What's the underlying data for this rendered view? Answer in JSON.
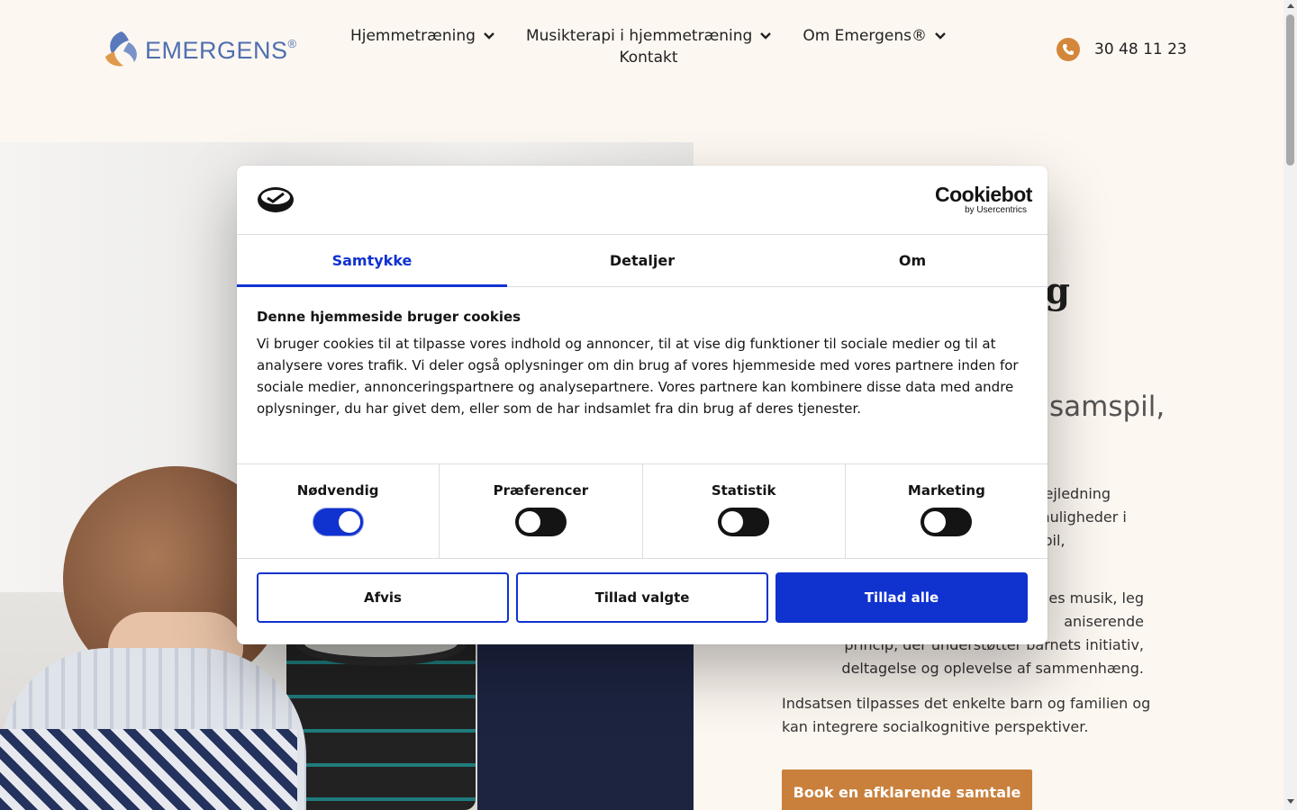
{
  "header": {
    "logo_text": "EMERGENS",
    "logo_reg": "®",
    "nav": [
      {
        "label": "Hjemmetræning"
      },
      {
        "label": "Musikterapi i hjemmetræning"
      },
      {
        "label": "Om Emergens®"
      }
    ],
    "nav_contact": "Kontakt",
    "phone": "30 48 11 23"
  },
  "hero": {
    "title_visible": "g",
    "subtitle_visible": "samspil,",
    "p1": "vejledning\nmuligheder i\nspil,",
    "p2": "des musik, leg\naniserende\nprincip, der understøtter barnets initiativ,\ndeltagelse og oplevelse af sammenhæng.",
    "p3": "Indsatsen tilpasses det enkelte barn og familien og kan integrere socialkognitive perspektiver.",
    "book_button": "Book en afklarende samtale"
  },
  "cookie": {
    "brand_main": "Cookiebot",
    "brand_sub": "by Usercentrics",
    "tabs": [
      {
        "label": "Samtykke",
        "active": true
      },
      {
        "label": "Detaljer",
        "active": false
      },
      {
        "label": "Om",
        "active": false
      }
    ],
    "heading": "Denne hjemmeside bruger cookies",
    "text": "Vi bruger cookies til at tilpasse vores indhold og annoncer, til at vise dig funktioner til sociale medier og til at analysere vores trafik. Vi deler også oplysninger om din brug af vores hjemmeside med vores partnere inden for sociale medier, annonceringspartnere og analysepartnere. Vores partnere kan kombinere disse data med andre oplysninger, du har givet dem, eller som de har indsamlet fra din brug af deres tjenester.",
    "toggles": [
      {
        "label": "Nødvendig",
        "on": true
      },
      {
        "label": "Præferencer",
        "on": false
      },
      {
        "label": "Statistik",
        "on": false
      },
      {
        "label": "Marketing",
        "on": false
      }
    ],
    "buttons": {
      "reject": "Afvis",
      "allow_selected": "Tillad valgte",
      "allow_all": "Tillad alle"
    }
  },
  "colors": {
    "accent": "#1032cf",
    "brand_orange": "#c9803c",
    "background": "#fdf7f1"
  }
}
